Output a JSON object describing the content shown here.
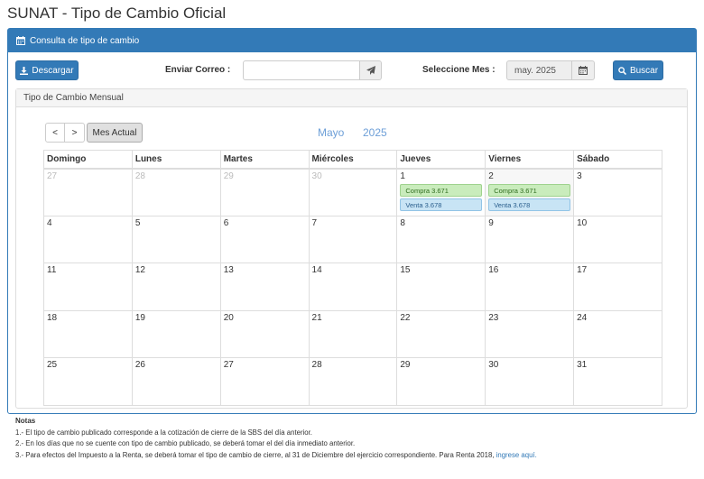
{
  "page": {
    "title": "SUNAT - Tipo de Cambio Oficial"
  },
  "panel": {
    "heading": "Consulta de tipo de cambio",
    "heading_icon": "calendar-icon",
    "accent": "#337ab7"
  },
  "toolbar": {
    "download_label": "Descargar",
    "email_label": "Enviar Correo :",
    "email_value": "",
    "month_label": "Seleccione Mes :",
    "month_value": "may. 2025",
    "search_label": "Buscar"
  },
  "calendar": {
    "panel_title": "Tipo de Cambio Mensual",
    "prev_label": "<",
    "next_label": ">",
    "today_label": "Mes Actual",
    "month": "Mayo",
    "year": "2025",
    "weekdays": [
      "Domingo",
      "Lunes",
      "Martes",
      "Miércoles",
      "Jueves",
      "Viernes",
      "Sábado"
    ],
    "weeks": [
      [
        {
          "day": "27",
          "other": true
        },
        {
          "day": "28",
          "other": true
        },
        {
          "day": "29",
          "other": true
        },
        {
          "day": "30",
          "other": true
        },
        {
          "day": "1",
          "buy": "Compra 3.671",
          "sell": "Venta 3.678"
        },
        {
          "day": "2",
          "today": true,
          "buy": "Compra 3.671",
          "sell": "Venta 3.678"
        },
        {
          "day": "3"
        }
      ],
      [
        {
          "day": "4"
        },
        {
          "day": "5"
        },
        {
          "day": "6"
        },
        {
          "day": "7"
        },
        {
          "day": "8"
        },
        {
          "day": "9"
        },
        {
          "day": "10"
        }
      ],
      [
        {
          "day": "11"
        },
        {
          "day": "12"
        },
        {
          "day": "13"
        },
        {
          "day": "14"
        },
        {
          "day": "15"
        },
        {
          "day": "16"
        },
        {
          "day": "17"
        }
      ],
      [
        {
          "day": "18"
        },
        {
          "day": "19"
        },
        {
          "day": "20"
        },
        {
          "day": "21"
        },
        {
          "day": "22"
        },
        {
          "day": "23"
        },
        {
          "day": "24"
        }
      ],
      [
        {
          "day": "25"
        },
        {
          "day": "26"
        },
        {
          "day": "27"
        },
        {
          "day": "28"
        },
        {
          "day": "29"
        },
        {
          "day": "30"
        },
        {
          "day": "31"
        }
      ]
    ]
  },
  "notes": {
    "title": "Notas",
    "line1": "1.- El tipo de cambio publicado corresponde a la cotización de cierre de la SBS del día anterior.",
    "line2": "2.- En los días que no se cuente con tipo de cambio publicado, se deberá tomar el del día inmediato anterior.",
    "line3": "3.- Para efectos del Impuesto a la Renta, se deberá tomar el tipo de cambio de cierre, al 31 de Diciembre del ejercicio correspondiente. Para Renta 2018,",
    "link": "ingrese aquí."
  }
}
